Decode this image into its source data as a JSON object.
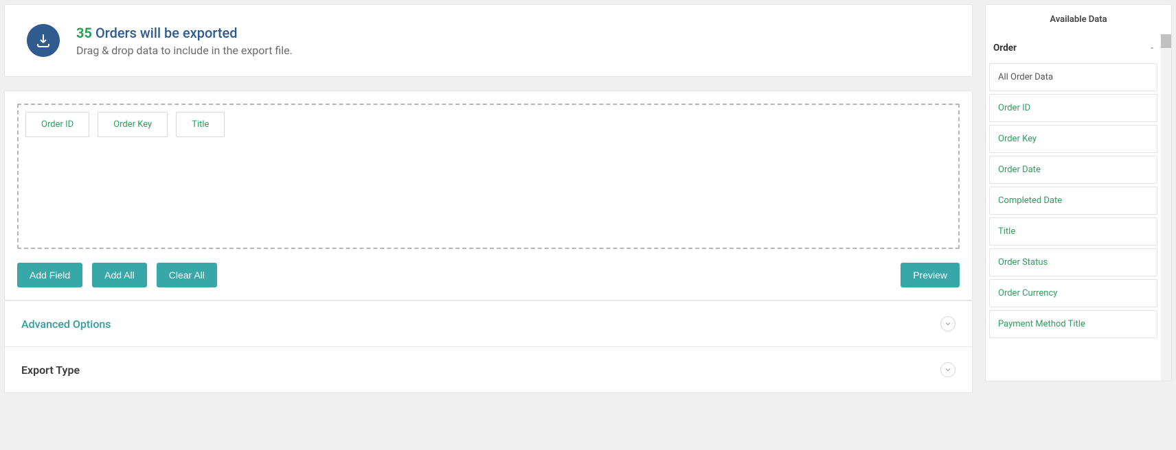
{
  "header": {
    "count": "35",
    "title_rest": "Orders will be exported",
    "subtitle": "Drag & drop data to include in the export file."
  },
  "dropzone": {
    "chips": [
      "Order ID",
      "Order Key",
      "Title"
    ]
  },
  "buttons": {
    "add_field": "Add Field",
    "add_all": "Add All",
    "clear_all": "Clear All",
    "preview": "Preview"
  },
  "sections": {
    "advanced_options": "Advanced Options",
    "export_type": "Export Type"
  },
  "sidebar": {
    "title": "Available Data",
    "group": {
      "label": "Order",
      "collapse_symbol": "-"
    },
    "items": [
      {
        "label": "All Order Data",
        "plain": true
      },
      {
        "label": "Order ID"
      },
      {
        "label": "Order Key"
      },
      {
        "label": "Order Date"
      },
      {
        "label": "Completed Date"
      },
      {
        "label": "Title"
      },
      {
        "label": "Order Status"
      },
      {
        "label": "Order Currency"
      },
      {
        "label": "Payment Method Title"
      }
    ]
  }
}
